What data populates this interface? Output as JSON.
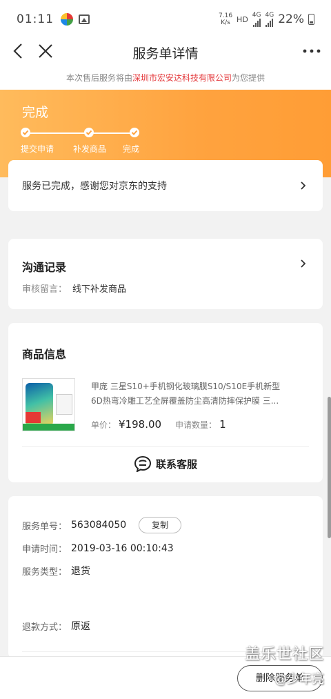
{
  "status_bar": {
    "time": "01:11",
    "net_speed_value": "7.16",
    "net_speed_unit": "K/s",
    "hd": "HD",
    "net1": "4G",
    "net2": "4G",
    "battery": "22%"
  },
  "nav": {
    "title": "服务单详情"
  },
  "notice": {
    "prefix": "本次售后服务将由",
    "company": "深圳市宏安达科技有限公司",
    "suffix": "为您提供"
  },
  "progress": {
    "status": "完成",
    "steps": [
      "提交申请",
      "补发商品",
      "完成"
    ]
  },
  "done_card": {
    "text": "服务已完成，感谢您对京东的支持"
  },
  "communication": {
    "title": "沟通记录",
    "note_label": "审核留言：",
    "note_value": "线下补发商品"
  },
  "goods": {
    "title": "商品信息",
    "name_line1": "甲庞 三星S10+手机钢化玻璃膜S10/S10E手机新型",
    "name_line2": "6D热弯冷雕工艺全屏覆盖防尘高清防摔保护膜 三...",
    "price_label": "单价：",
    "price": "¥198.00",
    "qty_label": "申请数量：",
    "qty": "1",
    "service_label": "联系客服"
  },
  "info": {
    "order_label": "服务单号：",
    "order_no": "563084050",
    "copy": "复制",
    "time_label": "申请时间：",
    "time": "2019-03-16 00:10:43",
    "type_label": "服务类型：",
    "type": "退货",
    "refund_label": "退款方式：",
    "refund": "原返"
  },
  "bottom": {
    "delete": "删除服务单"
  },
  "watermark": {
    "line1": "盖乐世社区",
    "line2": "@少年亮"
  }
}
